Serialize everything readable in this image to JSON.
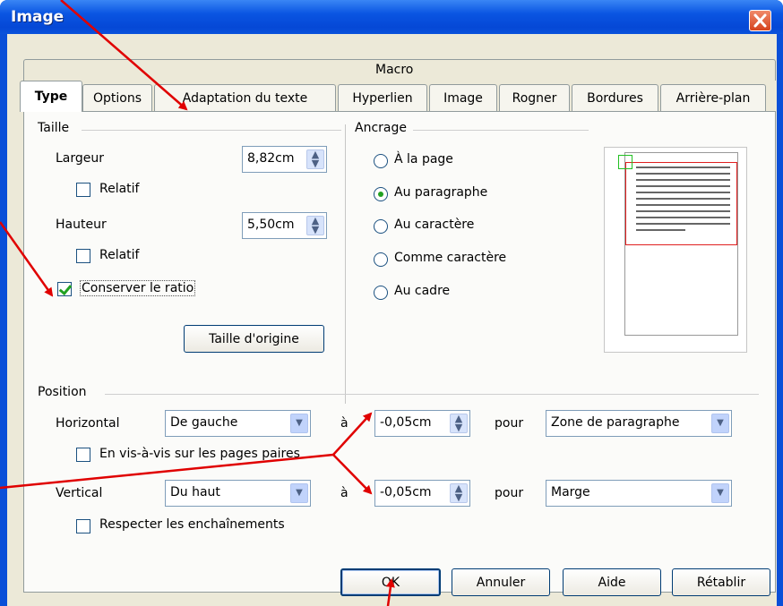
{
  "window": {
    "title": "Image",
    "close_label": "✕"
  },
  "tabs": {
    "macro": "Macro",
    "row": [
      "Type",
      "Options",
      "Adaptation du texte",
      "Hyperlien",
      "Image",
      "Rogner",
      "Bordures",
      "Arrière-plan"
    ],
    "active": "Type"
  },
  "taille": {
    "legend": "Taille",
    "largeur_label": "Largeur",
    "largeur_value": "8,82cm",
    "relatif1_label": "Relatif",
    "relatif1_checked": false,
    "hauteur_label": "Hauteur",
    "hauteur_value": "5,50cm",
    "relatif2_label": "Relatif",
    "relatif2_checked": false,
    "ratio_label": "Conserver le ratio",
    "ratio_checked": true,
    "origine_button": "Taille d'origine"
  },
  "ancrage": {
    "legend": "Ancrage",
    "options": [
      "À la page",
      "Au paragraphe",
      "Au caractère",
      "Comme caractère",
      "Au cadre"
    ],
    "selected": "Au paragraphe"
  },
  "position": {
    "legend": "Position",
    "horizontal_label": "Horizontal",
    "horizontal_value": "De gauche",
    "a_label_1": "à",
    "h_offset": "-0,05cm",
    "pour_label_1": "pour",
    "h_pour_value": "Zone de paragraphe",
    "mirror_label": "En vis-à-vis sur les pages paires",
    "mirror_checked": false,
    "vertical_label": "Vertical",
    "vertical_value": "Du haut",
    "a_label_2": "à",
    "v_offset": "-0,05cm",
    "pour_label_2": "pour",
    "v_pour_value": "Marge",
    "follow_label": "Respecter les enchaînements",
    "follow_checked": false
  },
  "buttons": {
    "ok": "OK",
    "cancel": "Annuler",
    "help": "Aide",
    "reset": "Rétablir"
  },
  "colors": {
    "titlebar": "#0a55e2",
    "dialog_bg": "#ece9d8",
    "annotation_arrow": "#e00000",
    "selection_frame": "#e02020",
    "anchor_marker": "#22c022"
  }
}
